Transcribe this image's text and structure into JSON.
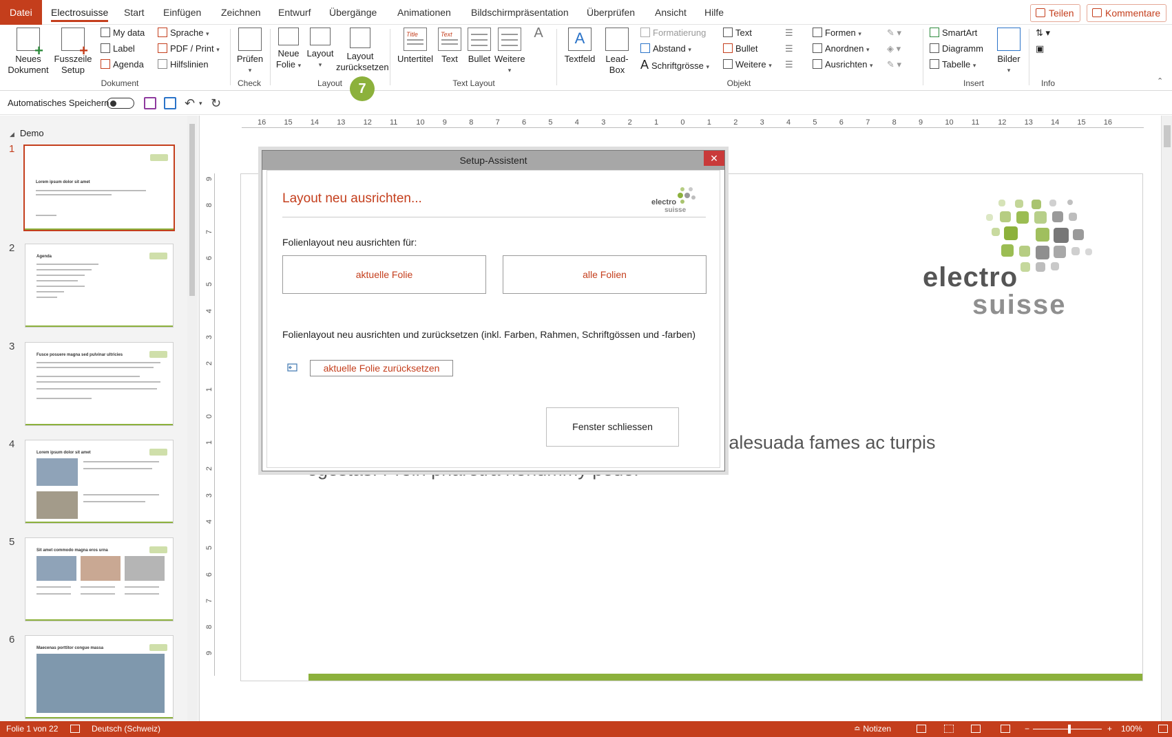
{
  "tabs": [
    "Datei",
    "Electrosuisse",
    "Start",
    "Einfügen",
    "Zeichnen",
    "Entwurf",
    "Übergänge",
    "Animationen",
    "Bildschirmpräsentation",
    "Überprüfen",
    "Ansicht",
    "Hilfe"
  ],
  "share": {
    "teilen": "Teilen",
    "kommentare": "Kommentare"
  },
  "ribbon": {
    "dokument": {
      "neues_dokument_1": "Neues",
      "neues_dokument_2": "Dokument",
      "fusszeile_1": "Fusszeile",
      "fusszeile_2": "Setup",
      "my_data": "My data",
      "label": "Label",
      "agenda": "Agenda",
      "sprache": "Sprache",
      "pdf_print": "PDF / Print",
      "hilfslinien": "Hilfslinien",
      "group": "Dokument"
    },
    "check": {
      "pruefen": "Prüfen",
      "group": "Check"
    },
    "layout": {
      "neue_folie_1": "Neue",
      "neue_folie_2": "Folie",
      "layout": "Layout",
      "zurueck_1": "Layout",
      "zurueck_2": "zurücksetzen",
      "group": "Layout"
    },
    "text_layout": {
      "untertitel": "Untertitel",
      "text": "Text",
      "bullet": "Bullet",
      "weitere": "Weitere",
      "icon_title": "Title",
      "icon_text": "Text",
      "group": "Text Layout"
    },
    "objekt": {
      "textfeld": "Textfeld",
      "lead_1": "Lead-",
      "lead_2": "Box",
      "formatierung": "Formatierung",
      "abstand": "Abstand",
      "schriftgroesse": "Schriftgrösse",
      "text": "Text",
      "bullet": "Bullet",
      "weitere": "Weitere",
      "formen": "Formen",
      "anordnen": "Anordnen",
      "ausrichten": "Ausrichten",
      "group": "Objekt"
    },
    "insert": {
      "smartart": "SmartArt",
      "diagramm": "Diagramm",
      "tabelle": "Tabelle",
      "bilder": "Bilder",
      "group": "Insert"
    },
    "info": {
      "group": "Info"
    }
  },
  "badge": "7",
  "qat": {
    "autosave": "Automatisches Speichern"
  },
  "pane": {
    "section": "Demo",
    "slides": [
      {
        "num": "1",
        "title": "Lorem ipsum dolor sit amet"
      },
      {
        "num": "2",
        "title": "Agenda"
      },
      {
        "num": "3",
        "title": "Fusce posuere magna sed pulvinar ultricies"
      },
      {
        "num": "4",
        "title": "Lorem ipsum dolor sit amet"
      },
      {
        "num": "5",
        "title": "Sit amet commodo magna eros urna"
      },
      {
        "num": "6",
        "title": "Maecenas porttitor congue massa"
      }
    ]
  },
  "ruler": {
    "h": [
      "16",
      "15",
      "14",
      "13",
      "12",
      "11",
      "10",
      "9",
      "8",
      "7",
      "6",
      "5",
      "4",
      "3",
      "2",
      "1",
      "0",
      "1",
      "2",
      "3",
      "4",
      "5",
      "6",
      "7",
      "8",
      "9",
      "10",
      "11",
      "12",
      "13",
      "14",
      "15",
      "16"
    ],
    "v": [
      "9",
      "8",
      "7",
      "6",
      "5",
      "4",
      "3",
      "2",
      "1",
      "0",
      "1",
      "2",
      "3",
      "4",
      "5",
      "6",
      "7",
      "8",
      "9"
    ]
  },
  "slide": {
    "logo_electro": "electro",
    "logo_suisse": "suisse",
    "body_line1": "Pellentesque habitant morbi tristique senectus et malesuada fames ac turpis",
    "body_line2": "egestas. Proin pharetra nonummy pede."
  },
  "dialog": {
    "title": "Setup-Assistent",
    "close": "✕",
    "heading": "Layout neu ausrichten...",
    "prompt1": "Folienlayout neu ausrichten für:",
    "btn_current": "aktuelle Folie",
    "btn_all": "alle Folien",
    "prompt2": "Folienlayout neu ausrichten und zurücksetzen (inkl. Farben, Rahmen, Schriftgössen und -farben)",
    "btn_reset": "aktuelle Folie zurücksetzen",
    "btn_close": "Fenster schliessen",
    "logo_electro": "electro",
    "logo_suisse": "suisse"
  },
  "status": {
    "folie": "Folie 1 von 22",
    "sprache": "Deutsch (Schweiz)",
    "notizen": "Notizen",
    "zoom": "100%"
  },
  "colors": {
    "accent": "#c43e1c",
    "green": "#8cb13c"
  }
}
